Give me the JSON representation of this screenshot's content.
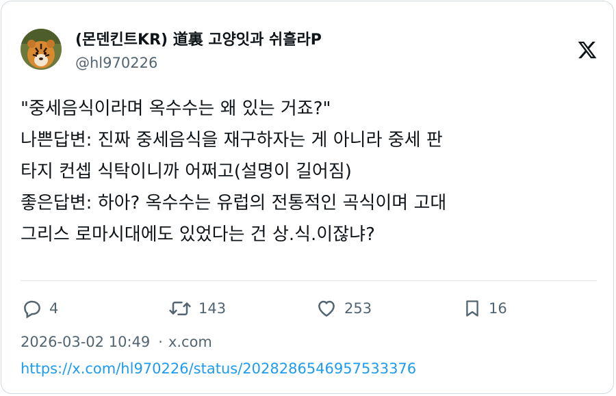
{
  "author": {
    "display_name": "(몬덴킨트KR) 道裏 고양잇과 쉬흘라P",
    "handle": "@hl970226",
    "avatar_icon": "tiger-avatar"
  },
  "platform_icon": "x-logo-icon",
  "tweet": {
    "lines": [
      "\"중세음식이라며 옥수수는 왜 있는 거죠?\"",
      "나쁜답변: 진짜 중세음식을 재구하자는 게 아니라 중세 판",
      "타지 컨셉 식탁이니까 어쩌고(설명이 길어짐)",
      "좋은답변: 하아? 옥수수는 유럽의 전통적인 곡식이며 고대",
      "그리스 로마시대에도 있었다는 건 상.식.이잖냐?"
    ]
  },
  "actions": {
    "reply": {
      "icon": "reply-icon",
      "count": "4"
    },
    "retweet": {
      "icon": "retweet-icon",
      "count": "143"
    },
    "like": {
      "icon": "heart-icon",
      "count": "253"
    },
    "bookmark": {
      "icon": "bookmark-icon",
      "count": "16"
    }
  },
  "meta": {
    "timestamp": "2026-03-02 10:49",
    "separator": "·",
    "source": "x.com"
  },
  "permalink": "https://x.com/hl970226/status/2028286546957533376",
  "colors": {
    "text": "#0f1419",
    "secondary": "#536471",
    "link": "#1d9bf0",
    "border": "#cfd9de"
  }
}
